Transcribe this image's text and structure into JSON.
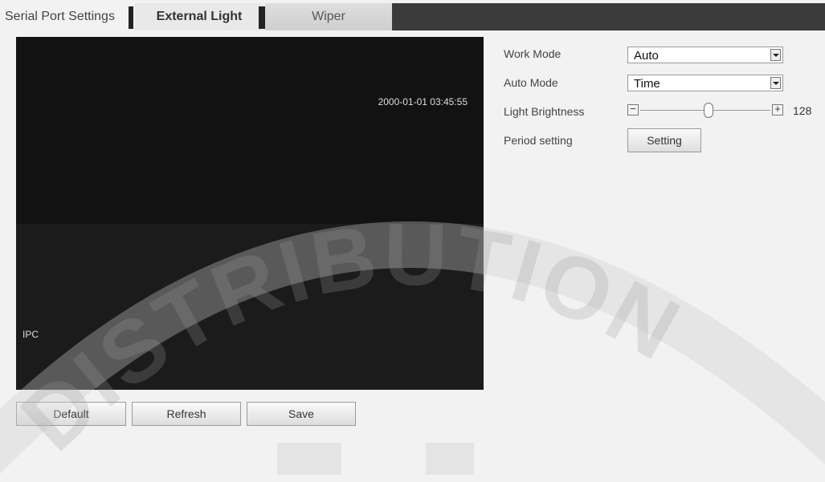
{
  "tabs": [
    {
      "label": "Serial Port Settings"
    },
    {
      "label": "External Light"
    },
    {
      "label": "Wiper"
    }
  ],
  "video": {
    "timestamp": "2000-01-01 03:45:55",
    "channel_label": "IPC"
  },
  "settings": {
    "work_mode": {
      "label": "Work Mode",
      "value": "Auto"
    },
    "auto_mode": {
      "label": "Auto Mode",
      "value": "Time"
    },
    "light_brightness": {
      "label": "Light Brightness",
      "value": "128"
    },
    "period": {
      "label": "Period setting",
      "button": "Setting"
    }
  },
  "actions": {
    "default": "Default",
    "refresh": "Refresh",
    "save": "Save"
  },
  "watermark": "DISTRIBUTION"
}
